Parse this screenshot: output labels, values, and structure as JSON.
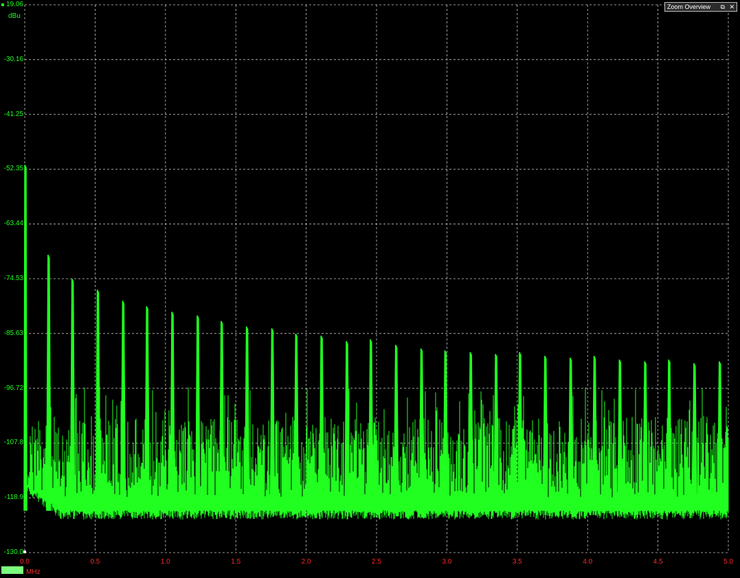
{
  "zoom_panel": {
    "title": "Zoom Overview",
    "restore_icon": "restore-icon",
    "close_icon": "close-icon"
  },
  "y_unit": "dBu",
  "x_unit": "MHz",
  "channel_badge": "",
  "colors": {
    "trace": "#20ff20",
    "y_axis_text": "#20ff20",
    "x_axis_text": "#ff2a2a",
    "grid": "#c8c8c8",
    "background": "#000000"
  },
  "chart_data": {
    "type": "line",
    "title": "",
    "xlabel": "MHz",
    "ylabel": "dBu",
    "xlim": [
      0.0,
      5.0
    ],
    "ylim": [
      -130.0,
      19.06
    ],
    "y_tick_labels": [
      "19.06",
      "-30.16",
      "-41.25",
      "-52.35",
      "-63.44",
      "-74.53",
      "-85.63",
      "-96.72",
      "-107.8",
      "-118.9",
      "-130.0"
    ],
    "x_tick_labels": [
      "0.0",
      "0.5",
      "1.0",
      "1.5",
      "2.0",
      "2.5",
      "3.0",
      "3.5",
      "4.0",
      "4.5",
      "5.0"
    ],
    "grid": true,
    "series": [
      {
        "peaks": [
          {
            "x": 0.005,
            "y": -24.5
          },
          {
            "x": 0.17,
            "y": -49.0
          },
          {
            "x": 0.34,
            "y": -55.5
          },
          {
            "x": 0.52,
            "y": -58.5
          },
          {
            "x": 0.7,
            "y": -61.5
          },
          {
            "x": 0.87,
            "y": -63.0
          },
          {
            "x": 1.05,
            "y": -64.5
          },
          {
            "x": 1.23,
            "y": -65.5
          },
          {
            "x": 1.4,
            "y": -67.0
          },
          {
            "x": 1.58,
            "y": -68.5
          },
          {
            "x": 1.76,
            "y": -69.0
          },
          {
            "x": 1.93,
            "y": -70.5
          },
          {
            "x": 2.11,
            "y": -71.0
          },
          {
            "x": 2.29,
            "y": -72.5
          },
          {
            "x": 2.46,
            "y": -72.0
          },
          {
            "x": 2.64,
            "y": -73.5
          },
          {
            "x": 2.82,
            "y": -74.5
          },
          {
            "x": 2.99,
            "y": -75.0
          },
          {
            "x": 3.17,
            "y": -75.5
          },
          {
            "x": 3.35,
            "y": -76.0
          },
          {
            "x": 3.52,
            "y": -75.5
          },
          {
            "x": 3.7,
            "y": -76.5
          },
          {
            "x": 3.88,
            "y": -77.0
          },
          {
            "x": 4.05,
            "y": -76.5
          },
          {
            "x": 4.23,
            "y": -77.5
          },
          {
            "x": 4.41,
            "y": -78.0
          },
          {
            "x": 4.58,
            "y": -77.5
          },
          {
            "x": 4.76,
            "y": -78.5
          },
          {
            "x": 4.94,
            "y": -78.0
          }
        ],
        "noise_floor_dBu": -118.5,
        "noise_top_dBu": -93.0
      }
    ]
  }
}
